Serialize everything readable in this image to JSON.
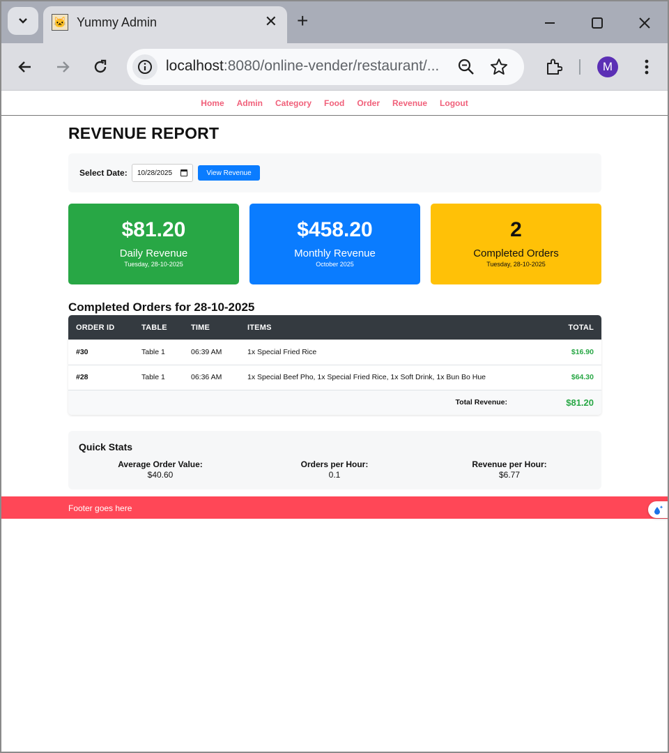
{
  "browser": {
    "tab_title": "Yummy Admin",
    "url_host": "localhost",
    "url_rest": ":8080/online-vender/restaurant/...",
    "profile_initial": "M"
  },
  "nav": [
    "Home",
    "Admin",
    "Category",
    "Food",
    "Order",
    "Revenue",
    "Logout"
  ],
  "page_title": "REVENUE REPORT",
  "date_filter": {
    "label": "Select Date:",
    "value": "10/28/2025",
    "button": "View Revenue"
  },
  "cards": [
    {
      "value": "$81.20",
      "label": "Daily Revenue",
      "sub": "Tuesday, 28-10-2025",
      "color": "#28a745",
      "text_color": "#ffffff"
    },
    {
      "value": "$458.20",
      "label": "Monthly Revenue",
      "sub": "October 2025",
      "color": "#0a7cff",
      "text_color": "#ffffff"
    },
    {
      "value": "2",
      "label": "Completed Orders",
      "sub": "Tuesday, 28-10-2025",
      "color": "#ffc107",
      "text_color": "#111111"
    }
  ],
  "orders": {
    "title": "Completed Orders for 28-10-2025",
    "headers": [
      "ORDER ID",
      "TABLE",
      "TIME",
      "ITEMS",
      "TOTAL"
    ],
    "rows": [
      {
        "id": "#30",
        "table": "Table 1",
        "time": "06:39 AM",
        "items": "1x Special Fried Rice",
        "total": "$16.90"
      },
      {
        "id": "#28",
        "table": "Table 1",
        "time": "06:36 AM",
        "items": "1x Special Beef Pho, 1x Special Fried Rice, 1x Soft Drink, 1x Bun Bo Hue",
        "total": "$64.30"
      }
    ],
    "total_label": "Total Revenue:",
    "total_value": "$81.20"
  },
  "quick_stats": {
    "title": "Quick Stats",
    "items": [
      {
        "label": "Average Order Value:",
        "value": "$40.60"
      },
      {
        "label": "Orders per Hour:",
        "value": "0.1"
      },
      {
        "label": "Revenue per Hour:",
        "value": "$6.77"
      }
    ]
  },
  "footer": "Footer goes here",
  "colors": {
    "accent_nav": "#f0607a",
    "footer": "#ff4757",
    "header_dark": "#343a40",
    "money_green": "#28a745"
  }
}
